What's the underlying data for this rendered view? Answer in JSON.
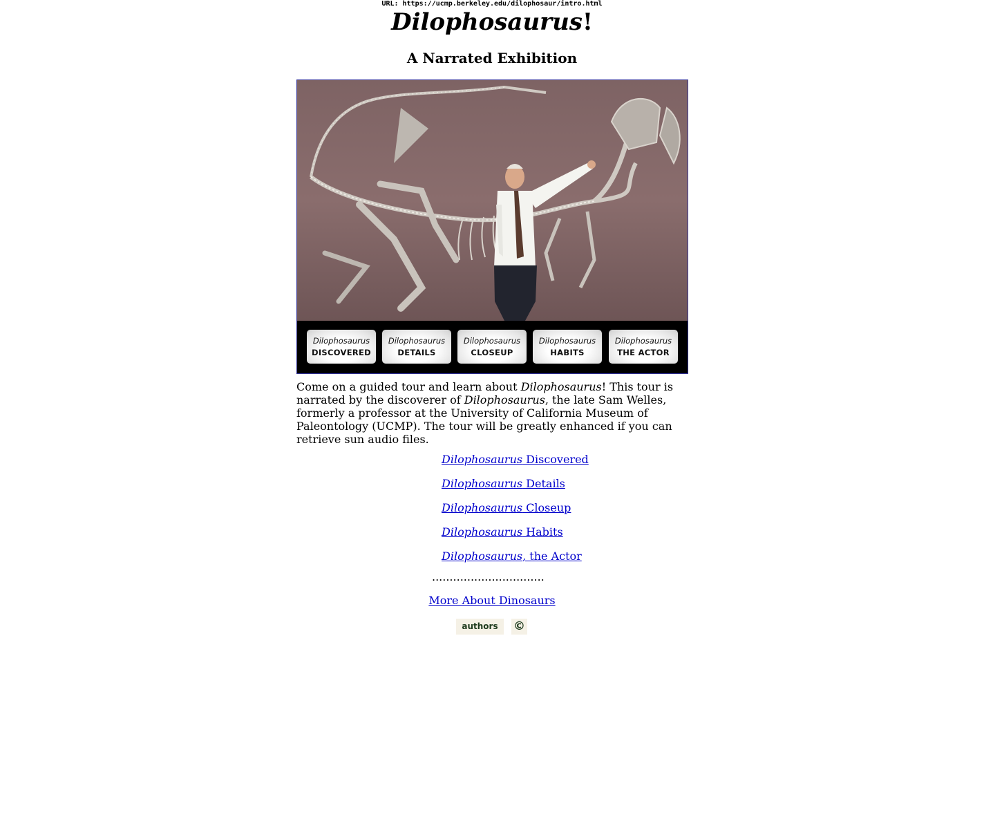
{
  "url_bar": "URL: https://ucmp.berkeley.edu/dilophosaur/intro.html",
  "header": {
    "title_italic": "Dilophosaurus",
    "title_suffix": "!",
    "subtitle": "A Narrated Exhibition"
  },
  "nav_buttons": [
    {
      "top": "Dilophosaurus",
      "caption": "DISCOVERED"
    },
    {
      "top": "Dilophosaurus",
      "caption": "DETAILS"
    },
    {
      "top": "Dilophosaurus",
      "caption": "CLOSEUP"
    },
    {
      "top": "Dilophosaurus",
      "caption": "HABITS"
    },
    {
      "top": "Dilophosaurus",
      "caption": "THE ACTOR"
    }
  ],
  "intro": {
    "p1": "Come on a guided tour and learn about ",
    "p1_italic": "Dilophosaurus",
    "p2": "! This tour is narrated by the discoverer of ",
    "p2_italic": "Dilophosaurus",
    "p3": ", the late Sam Welles, formerly a professor at the University of California Museum of Paleontology (UCMP). The tour will be greatly enhanced if you can retrieve sun audio files."
  },
  "links": [
    {
      "italic": "Dilophosaurus",
      "text": " Discovered"
    },
    {
      "italic": "Dilophosaurus",
      "text": " Details"
    },
    {
      "italic": "Dilophosaurus",
      "text": " Closeup"
    },
    {
      "italic": "Dilophosaurus",
      "text": " Habits"
    },
    {
      "italic": "Dilophosaurus",
      "text": ", the Actor"
    }
  ],
  "dots": "................................",
  "more_link": "More About Dinosaurs",
  "footer": {
    "authors_label": "authors",
    "copyright_symbol": "©"
  },
  "colors": {
    "link": "#0000cc",
    "hero_border": "#33339a",
    "badge_bg": "#f5f1e6",
    "badge_text": "#1e3b1e"
  }
}
